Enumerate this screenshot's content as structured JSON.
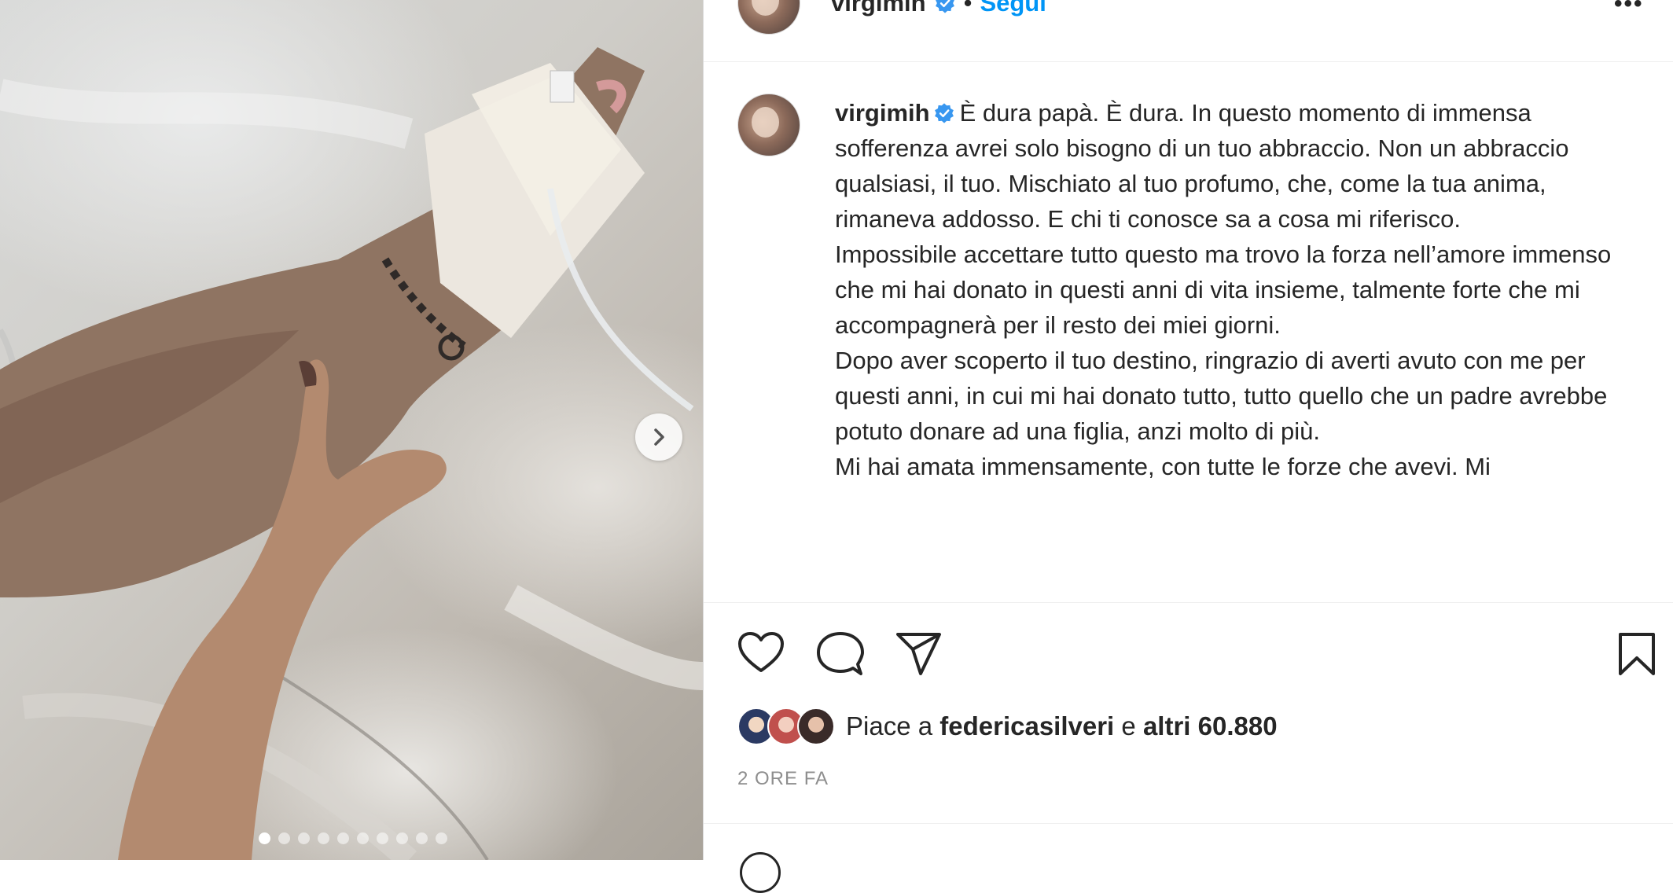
{
  "post": {
    "username": "virgimih",
    "dot_separator": "•",
    "follow_label": "Segui",
    "more_label": "•••",
    "caption_paragraphs": [
      "È dura papà. È dura. In questo momento di immensa sofferenza avrei solo bisogno di un tuo abbraccio. Non un abbraccio qualsiasi, il tuo. Mischiato al tuo profumo, che, come la tua anima, rimaneva addosso. E chi ti conosce sa a cosa mi riferisco.",
      "Impossibile accettare tutto questo ma trovo la forza nell’amore immenso che mi hai donato in questi anni di vita insieme, talmente forte che mi accompagnerà per il resto dei miei giorni.",
      "Dopo aver scoperto il tuo destino, ringrazio di averti avuto con me per questi anni, in cui mi hai donato tutto, tutto quello che un padre avrebbe potuto donare ad una figlia, anzi molto di più.",
      "Mi hai amata immensamente, con tutte le forze che avevi. Mi"
    ],
    "likes": {
      "prefix": "Piace a",
      "first_liker": "federicasilveri",
      "joiner": "e",
      "others": "altri 60.880"
    },
    "timestamp": "2 ORE FA"
  },
  "carousel": {
    "total_slides": 10,
    "active_index": 0
  },
  "icons": {
    "like": "heart-icon",
    "comment": "comment-icon",
    "share": "share-icon",
    "save": "bookmark-icon",
    "next": "chevron-right-icon",
    "verified": "verified-badge-icon"
  },
  "colors": {
    "follow": "#0095f6",
    "verified": "#3897f0",
    "text": "#262626",
    "muted": "#8e8e8e"
  }
}
